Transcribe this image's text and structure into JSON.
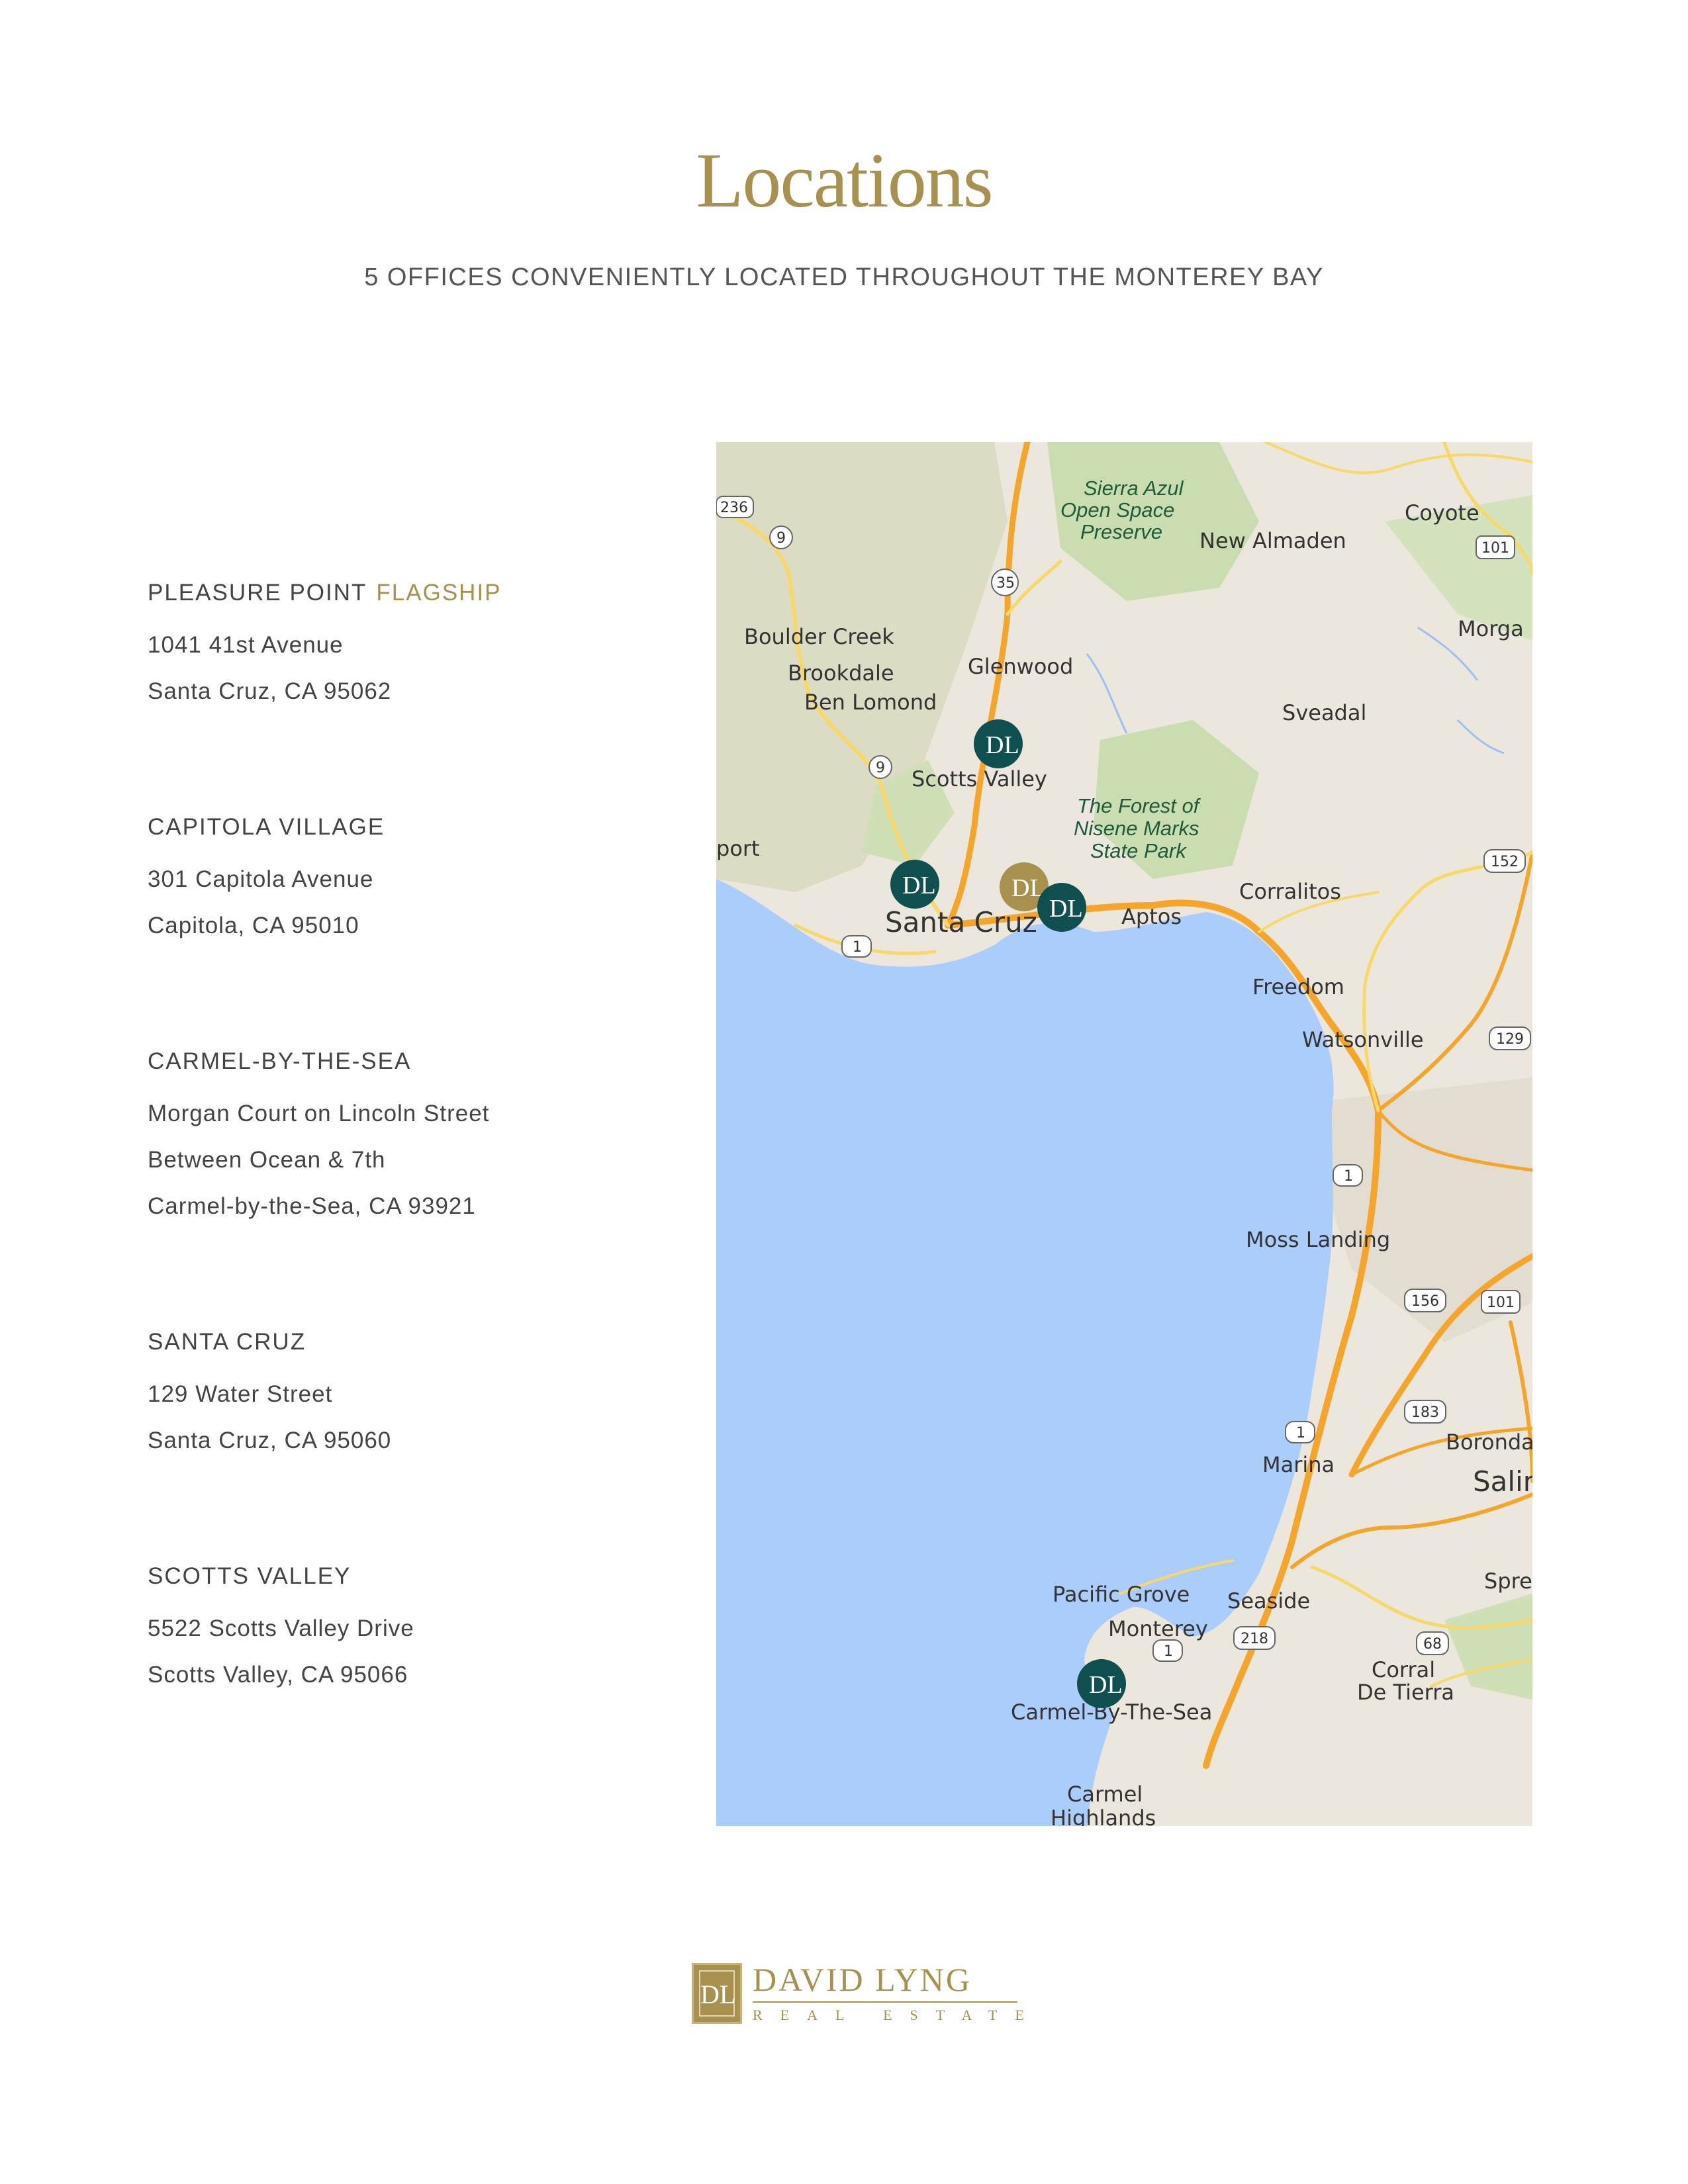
{
  "page": {
    "title": "Locations",
    "subtitle": "5 OFFICES CONVENIENTLY LOCATED THROUGHOUT THE MONTEREY BAY"
  },
  "offices": [
    {
      "name": "PLEASURE POINT",
      "badge": "FLAGSHIP",
      "lines": [
        "1041 41st Avenue",
        "Santa Cruz, CA 95062"
      ]
    },
    {
      "name": "CAPITOLA VILLAGE",
      "lines": [
        "301 Capitola Avenue",
        "Capitola, CA 95010"
      ]
    },
    {
      "name": "CARMEL-BY-THE-SEA",
      "lines": [
        "Morgan Court on Lincoln Street",
        "Between Ocean & 7th",
        "Carmel-by-the-Sea, CA 93921"
      ]
    },
    {
      "name": "SANTA CRUZ",
      "lines": [
        "129 Water Street",
        "Santa Cruz, CA 95060"
      ]
    },
    {
      "name": "SCOTTS VALLEY",
      "lines": [
        "5522 Scotts Valley Drive",
        "Scotts Valley, CA 95066"
      ]
    }
  ],
  "map": {
    "places": {
      "sierra_azul": "Sierra Azul",
      "open_space": "Open Space",
      "preserve": "Preserve",
      "new_almaden": "New Almaden",
      "coyote": "Coyote",
      "morgan": "Morga",
      "boulder_creek": "Boulder Creek",
      "brookdale": "Brookdale",
      "ben_lomond": "Ben Lomond",
      "glenwood": "Glenwood",
      "sveadal": "Sveadal",
      "scotts_valley": "Scotts Valley",
      "forest_of": "The Forest of",
      "nisene_marks": "Nisene Marks",
      "state_park": "State Park",
      "port": "port",
      "santa_cruz": "Santa Cruz",
      "aptos": "Aptos",
      "corralitos": "Corralitos",
      "freedom": "Freedom",
      "watsonville": "Watsonville",
      "moss_landing": "Moss Landing",
      "marina": "Marina",
      "boronda": "Boronda",
      "salinas": "Salin",
      "pacific_grove": "Pacific Grove",
      "monterey": "Monterey",
      "seaside": "Seaside",
      "spreckels": "Spre",
      "corral": "Corral",
      "de_tierra": "De Tierra",
      "carmel_by_the_sea": "Carmel-By-The-Sea",
      "carmel": "Carmel",
      "highlands": "Highlands"
    },
    "shields": [
      "236",
      "9",
      "35",
      "101",
      "9",
      "152",
      "1",
      "129",
      "1",
      "156",
      "101",
      "183",
      "1",
      "218",
      "68",
      "1"
    ],
    "markers": [
      {
        "label": "DL",
        "kind": "office",
        "color": "#0f4f4f"
      },
      {
        "label": "DL",
        "kind": "office",
        "color": "#0f4f4f"
      },
      {
        "label": "DL",
        "kind": "flagship",
        "color": "#a8904f"
      },
      {
        "label": "DL",
        "kind": "office",
        "color": "#0f4f4f"
      },
      {
        "label": "DL",
        "kind": "office",
        "color": "#0f4f4f"
      }
    ]
  },
  "logo": {
    "monogram": "DL",
    "name": "DAVID LYNG",
    "tagline": "REAL ESTATE"
  }
}
